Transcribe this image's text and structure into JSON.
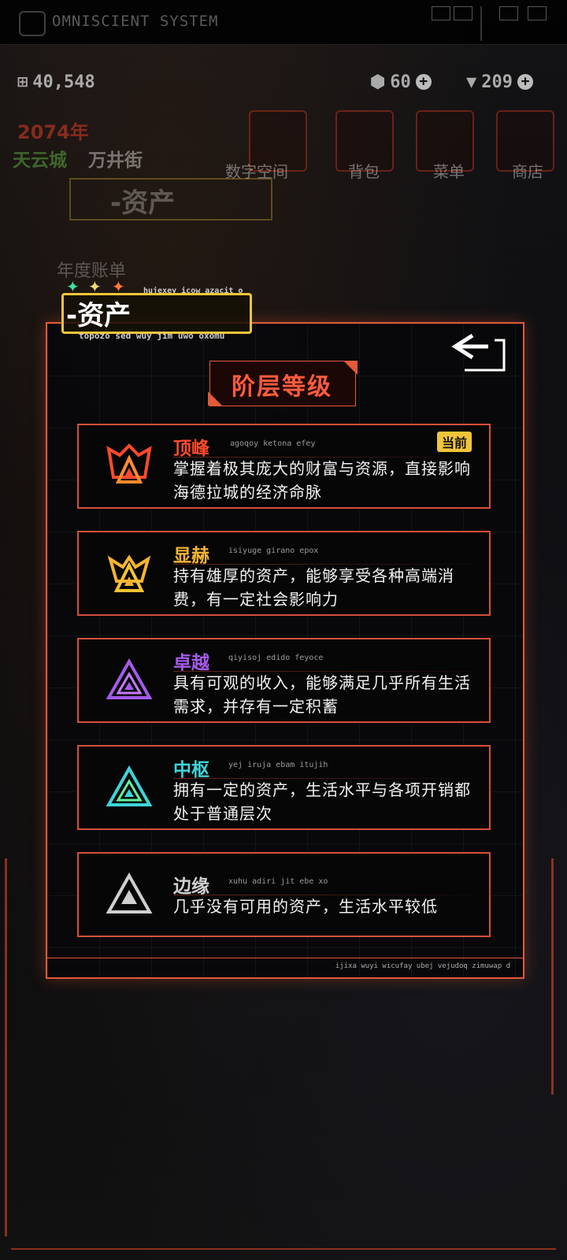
{
  "system": {
    "title": "OMNISCIENT SYSTEM"
  },
  "resources": {
    "money": "40,548",
    "gem_a": "60",
    "gem_b": "209",
    "plus": "+"
  },
  "background": {
    "year": "2074年",
    "city": "天云城",
    "street": "万井街",
    "nav": [
      "数字空间",
      "背包",
      "菜单",
      "商店"
    ],
    "ghost_title": "-资产",
    "ghost_subtitle": "年度账单"
  },
  "header": {
    "tag_label": "-资产",
    "tag_top": "hujexey icow azacit o",
    "tag_bottom": "topozo sed wuy jim uwo oxomu"
  },
  "section_title": "阶层等级",
  "current_label": "当前",
  "tiers": [
    {
      "name": "顶峰",
      "code": "agoqoy ketona efey",
      "desc": "掌握着极其庞大的财富与资源，直接影响海德拉城的经济命脉",
      "color": "#ff4a2e",
      "current": true
    },
    {
      "name": "显赫",
      "code": "isiyuge girano epox",
      "desc": "持有雄厚的资产，能够享受各种高端消费，有一定社会影响力",
      "color": "#f5b331",
      "current": false
    },
    {
      "name": "卓越",
      "code": "qiyisoj edido feyoce",
      "desc": "具有可观的收入，能够满足几乎所有生活需求，并存有一定积蓄",
      "color": "#a45ae8",
      "current": false
    },
    {
      "name": "中枢",
      "code": "yej iruja ebam itujih",
      "desc": "拥有一定的资产，生活水平与各项开销都处于普通层次",
      "color": "#3fd3d8",
      "current": false
    },
    {
      "name": "边缘",
      "code": "xuhu adiri jit ebe xo",
      "desc": "几乎没有可用的资产，生活水平较低",
      "color": "#d0d0d0",
      "current": false
    }
  ],
  "footer_text": "ijixa wuyi wicufay ubej vejudoq zimuwap d"
}
